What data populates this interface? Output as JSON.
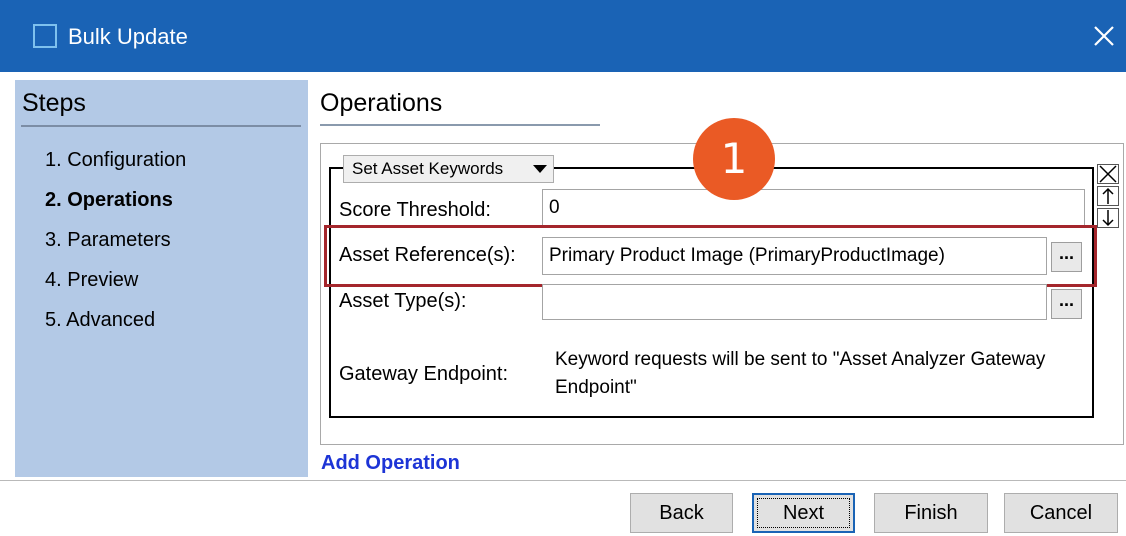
{
  "window": {
    "title": "Bulk Update",
    "icon": "window-icon",
    "close_icon": "close-icon"
  },
  "steps": {
    "header": "Steps",
    "items": [
      {
        "label": "1. Configuration",
        "active": false
      },
      {
        "label": "2. Operations",
        "active": true
      },
      {
        "label": "3. Parameters",
        "active": false
      },
      {
        "label": "4. Preview",
        "active": false
      },
      {
        "label": "5. Advanced",
        "active": false
      }
    ]
  },
  "operations": {
    "title": "Operations",
    "operation_select": "Set Asset Keywords",
    "callout_number": "1",
    "fields": {
      "score_threshold": {
        "label": "Score Threshold:",
        "value": "0"
      },
      "asset_references": {
        "label": "Asset Reference(s):",
        "value": "Primary Product Image (PrimaryProductImage)",
        "browse": "..."
      },
      "asset_types": {
        "label": "Asset Type(s):",
        "value": "",
        "browse": "..."
      },
      "gateway_endpoint": {
        "label": "Gateway Endpoint:",
        "text": "Keyword requests will be sent to \"Asset Analyzer Gateway Endpoint\""
      }
    },
    "side_buttons": [
      "remove-icon",
      "move-up-icon",
      "move-down-icon"
    ],
    "add_operation": "Add Operation"
  },
  "footer": {
    "back": "Back",
    "next": "Next",
    "finish": "Finish",
    "cancel": "Cancel"
  },
  "colors": {
    "titlebar": "#1a63b5",
    "steps_panel": "#b3c9e6",
    "callout": "#ea5a25",
    "highlight": "#a4262c",
    "link": "#1d34d6"
  }
}
